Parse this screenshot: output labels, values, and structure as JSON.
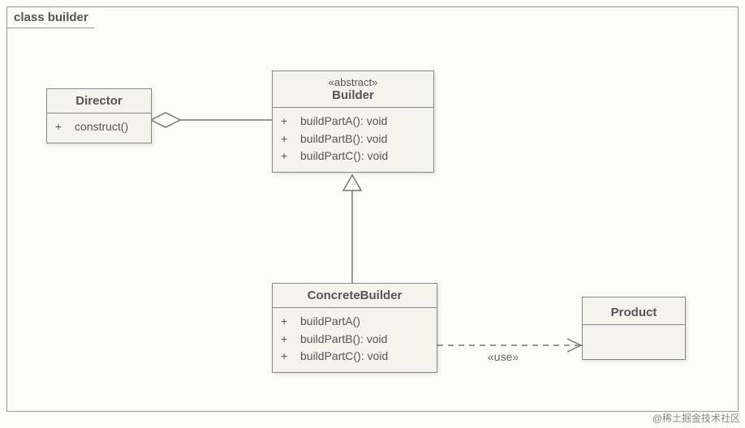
{
  "frame": {
    "label": "class builder"
  },
  "director": {
    "name": "Director",
    "methods": [
      {
        "vis": "+",
        "sig": "construct()"
      }
    ]
  },
  "builder": {
    "stereotype": "«abstract»",
    "name": "Builder",
    "methods": [
      {
        "vis": "+",
        "sig": "buildPartA(): void"
      },
      {
        "vis": "+",
        "sig": "buildPartB(): void"
      },
      {
        "vis": "+",
        "sig": "buildPartC(): void"
      }
    ]
  },
  "concrete": {
    "name": "ConcreteBuilder",
    "methods": [
      {
        "vis": "+",
        "sig": "buildPartA()"
      },
      {
        "vis": "+",
        "sig": "buildPartB(): void"
      },
      {
        "vis": "+",
        "sig": "buildPartC(): void"
      }
    ]
  },
  "product": {
    "name": "Product"
  },
  "relations": {
    "use_label": "«use»"
  },
  "watermark": "@稀土掘金技术社区"
}
